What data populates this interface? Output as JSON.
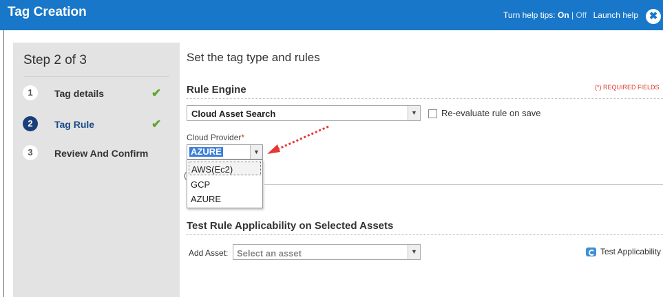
{
  "header": {
    "title": "Tag Creation",
    "help_prefix": "Turn help tips:",
    "help_on": "On",
    "help_sep": "|",
    "help_off": "Off",
    "launch_help": "Launch help",
    "close_glyph": "✖"
  },
  "sidebar": {
    "step_title": "Step 2 of 3",
    "steps": [
      {
        "num": "1",
        "label": "Tag details",
        "complete": true
      },
      {
        "num": "2",
        "label": "Tag Rule",
        "complete": true
      },
      {
        "num": "3",
        "label": "Review And Confirm",
        "complete": false
      }
    ],
    "check_glyph": "✔"
  },
  "main": {
    "title": "Set the tag type and rules",
    "rule_engine": {
      "heading": "Rule Engine",
      "required_note": "(*) REQUIRED FIELDS",
      "selected": "Cloud Asset Search",
      "reevaluate_label": "Re-evaluate rule on save",
      "reevaluate_checked": false
    },
    "cloud_provider": {
      "label": "Cloud Provider",
      "required_mark": "*",
      "selected": "AZURE",
      "options": [
        "AWS(Ec2)",
        "GCP",
        "AZURE"
      ],
      "highlighted_option": "AWS(Ec2)",
      "hidden_label_fragment": "("
    },
    "test_section": {
      "heading": "Test Rule Applicability on Selected Assets",
      "add_asset_label": "Add Asset:",
      "asset_placeholder": "Select an asset",
      "test_button": "Test Applicability"
    }
  },
  "icons": {
    "dropdown_arrow": "▼",
    "checkmark": "check-icon",
    "close": "close-icon",
    "test": "refresh-icon"
  },
  "colors": {
    "header_bg": "#1877c8",
    "active_step": "#1a3e7a",
    "check_green": "#5ca72c",
    "required_red": "#d9352b",
    "highlight_blue": "#3c7fd8",
    "annotation_arrow": "#e53935"
  }
}
